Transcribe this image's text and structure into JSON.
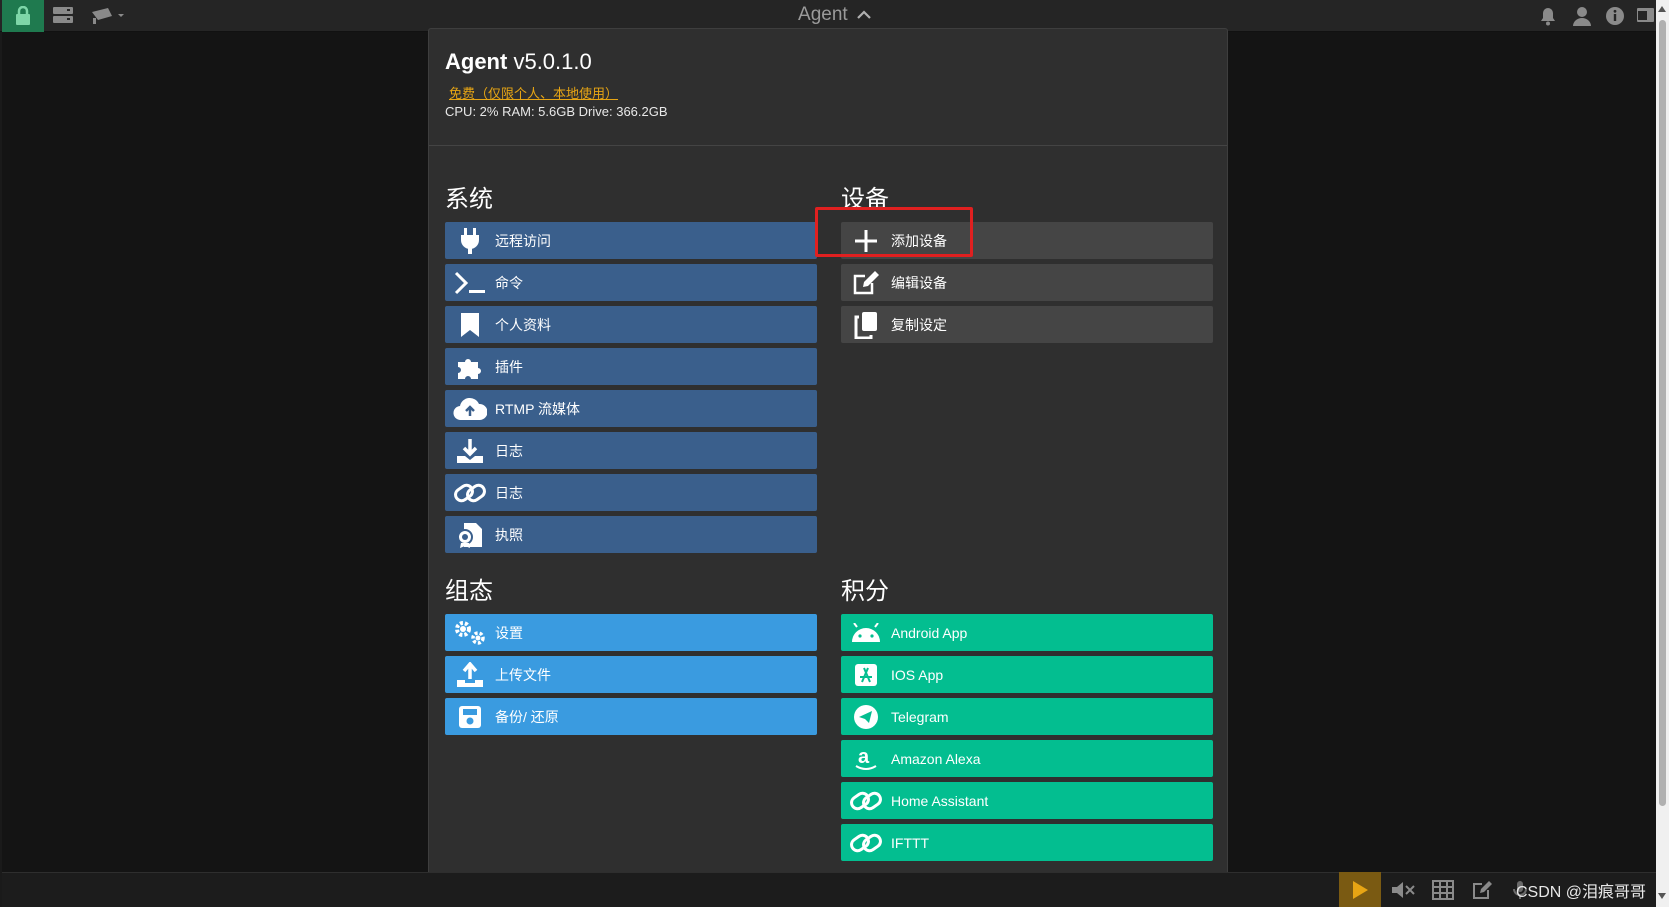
{
  "topbar": {
    "title": "Agent",
    "icons": [
      "lock-icon",
      "server-icon",
      "camera-icon",
      "bell-icon",
      "user-icon",
      "info-icon",
      "panel-icon"
    ]
  },
  "dialog": {
    "app_name": "Agent",
    "version": "v5.0.1.0",
    "license": "免费（仅限个人、本地使用）",
    "stats": "CPU: 2% RAM: 5.6GB Drive: 366.2GB"
  },
  "system": {
    "title": "系统",
    "items": [
      {
        "label": "远程访问",
        "icon": "plug-icon"
      },
      {
        "label": "命令",
        "icon": "terminal-icon"
      },
      {
        "label": "个人资料",
        "icon": "bookmark-icon"
      },
      {
        "label": "插件",
        "icon": "puzzle-icon"
      },
      {
        "label": "RTMP 流媒体",
        "icon": "cloud-upload-icon"
      },
      {
        "label": "日志",
        "icon": "download-icon"
      },
      {
        "label": "日志",
        "icon": "link-icon"
      },
      {
        "label": "执照",
        "icon": "certificate-icon"
      }
    ]
  },
  "devices": {
    "title": "设备",
    "items": [
      {
        "label": "添加设备",
        "icon": "plus-icon"
      },
      {
        "label": "编辑设备",
        "icon": "edit-icon"
      },
      {
        "label": "复制设定",
        "icon": "copy-icon"
      }
    ]
  },
  "config": {
    "title": "组态",
    "items": [
      {
        "label": "设置",
        "icon": "gears-icon"
      },
      {
        "label": "上传文件",
        "icon": "upload-icon"
      },
      {
        "label": "备份/ 还原",
        "icon": "save-icon"
      }
    ]
  },
  "integrations": {
    "title": "积分",
    "items": [
      {
        "label": "Android App",
        "icon": "android-icon"
      },
      {
        "label": "IOS App",
        "icon": "appstore-icon"
      },
      {
        "label": "Telegram",
        "icon": "telegram-icon"
      },
      {
        "label": "Amazon Alexa",
        "icon": "amazon-icon"
      },
      {
        "label": "Home Assistant",
        "icon": "link-icon"
      },
      {
        "label": "IFTTT",
        "icon": "link-icon"
      }
    ]
  },
  "bottombar": {
    "icons": [
      "play-icon",
      "mute-icon",
      "grid-icon",
      "edit-icon",
      "mic-icon",
      "shield-icon"
    ]
  },
  "watermark": "CSDN @泪痕哥哥",
  "colors": {
    "system_btn": "#3a5f8c",
    "device_btn": "#454545",
    "config_btn": "#3a9be0",
    "integration_btn": "#03be90",
    "license_text": "#e7a514",
    "highlight": "#e02020"
  }
}
